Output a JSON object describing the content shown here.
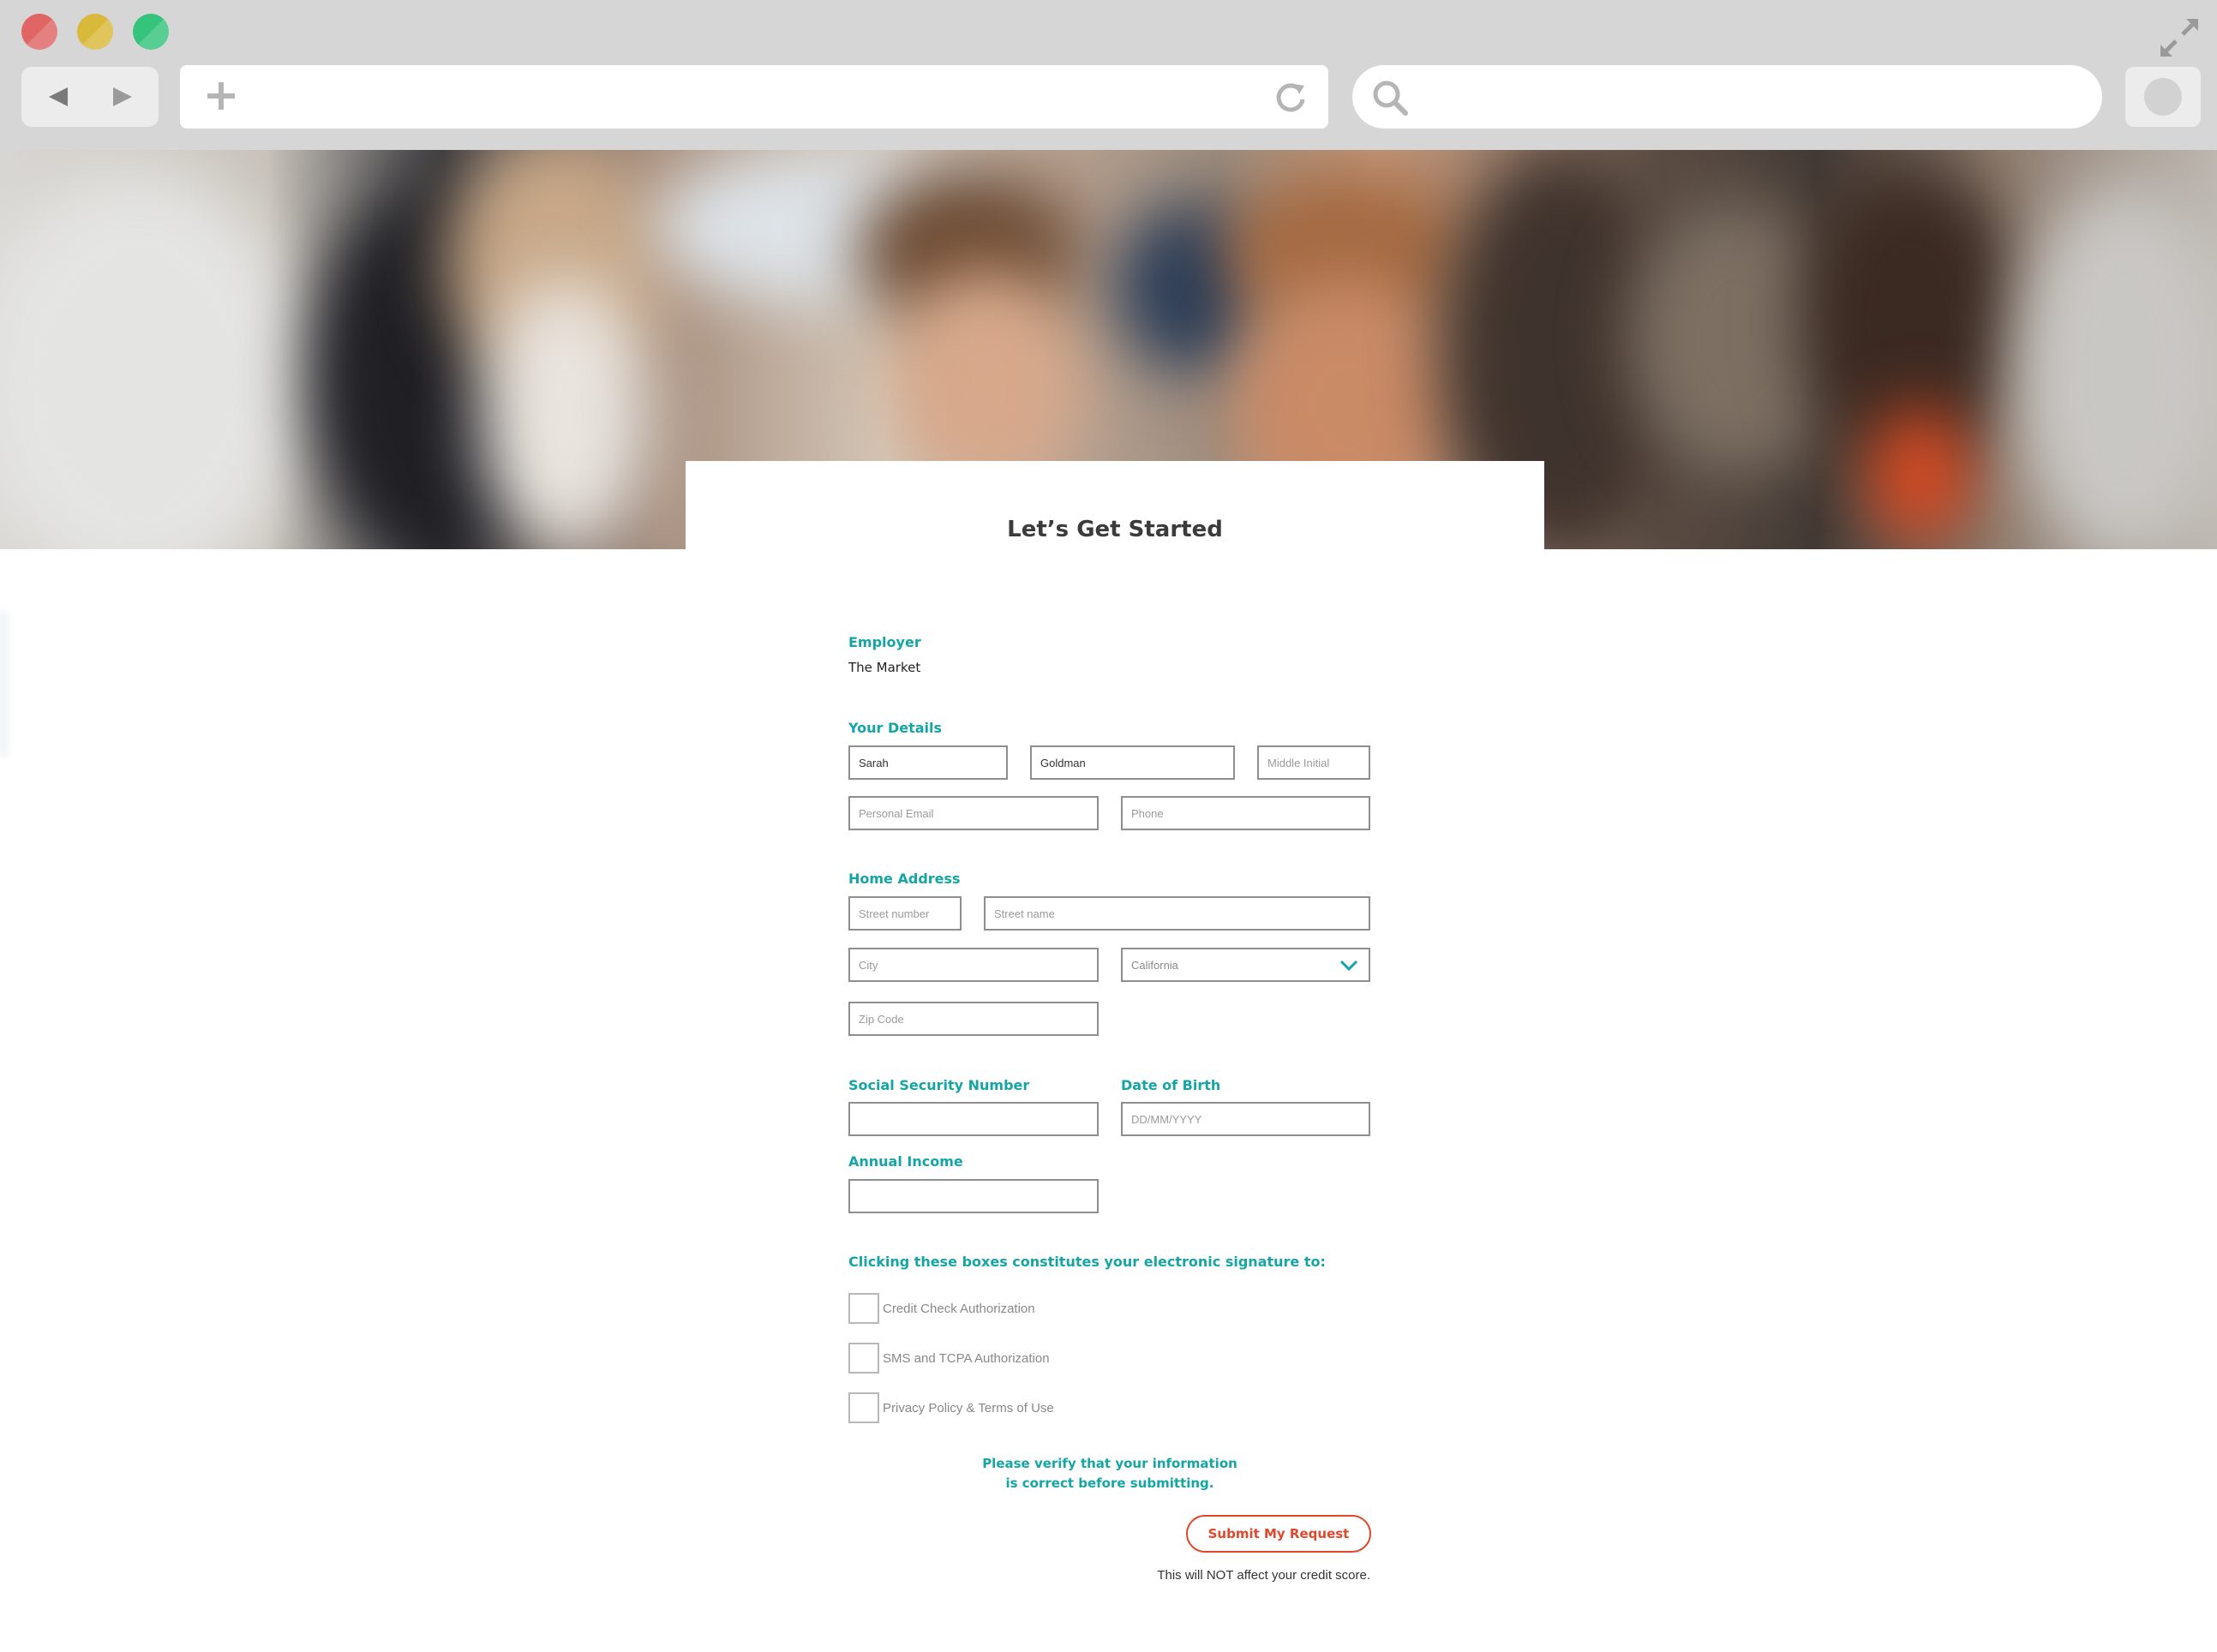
{
  "browser": {
    "window_controls": [
      "close",
      "minimize",
      "maximize"
    ],
    "icons": [
      "back-arrow-icon",
      "forward-arrow-icon",
      "plus-icon",
      "reload-icon",
      "search-icon",
      "expand-icon"
    ],
    "url": "",
    "search_query": ""
  },
  "hero": {
    "image": "blurred-photo-of-coworkers"
  },
  "form": {
    "title": "Let’s Get Started",
    "employer": {
      "label": "Employer",
      "value": "The Market"
    },
    "details": {
      "label": "Your Details",
      "first_name": "Sarah",
      "last_name": "Goldman",
      "middle_initial_placeholder": "Middle Initial",
      "email_placeholder": "Personal Email",
      "phone_placeholder": "Phone"
    },
    "address": {
      "label": "Home Address",
      "street_number_placeholder": "Street number",
      "street_name_placeholder": "Street name",
      "city_placeholder": "City",
      "state_selected": "California",
      "zip_placeholder": "Zip Code"
    },
    "ssn": {
      "label": "Social Security Number",
      "value": ""
    },
    "dob": {
      "label": "Date of Birth",
      "placeholder": "DD/MM/YYYY"
    },
    "income": {
      "label": "Annual Income",
      "value": ""
    },
    "signature": {
      "label": "Clicking these boxes constitutes your electronic signature to:",
      "items": [
        {
          "label": "Credit Check Authorization",
          "checked": false
        },
        {
          "label": "SMS and TCPA Authorization",
          "checked": false
        },
        {
          "label": "Privacy Policy & Terms of Use",
          "checked": false
        }
      ]
    },
    "verify_line1": "Please verify that your information",
    "verify_line2": "is correct before submitting.",
    "submit_label": "Submit My Request",
    "note": "This will NOT affect your credit score."
  },
  "colors": {
    "accent": "#15a5a5",
    "submit": "#e0472b",
    "chrome": "#d6d6d6"
  }
}
